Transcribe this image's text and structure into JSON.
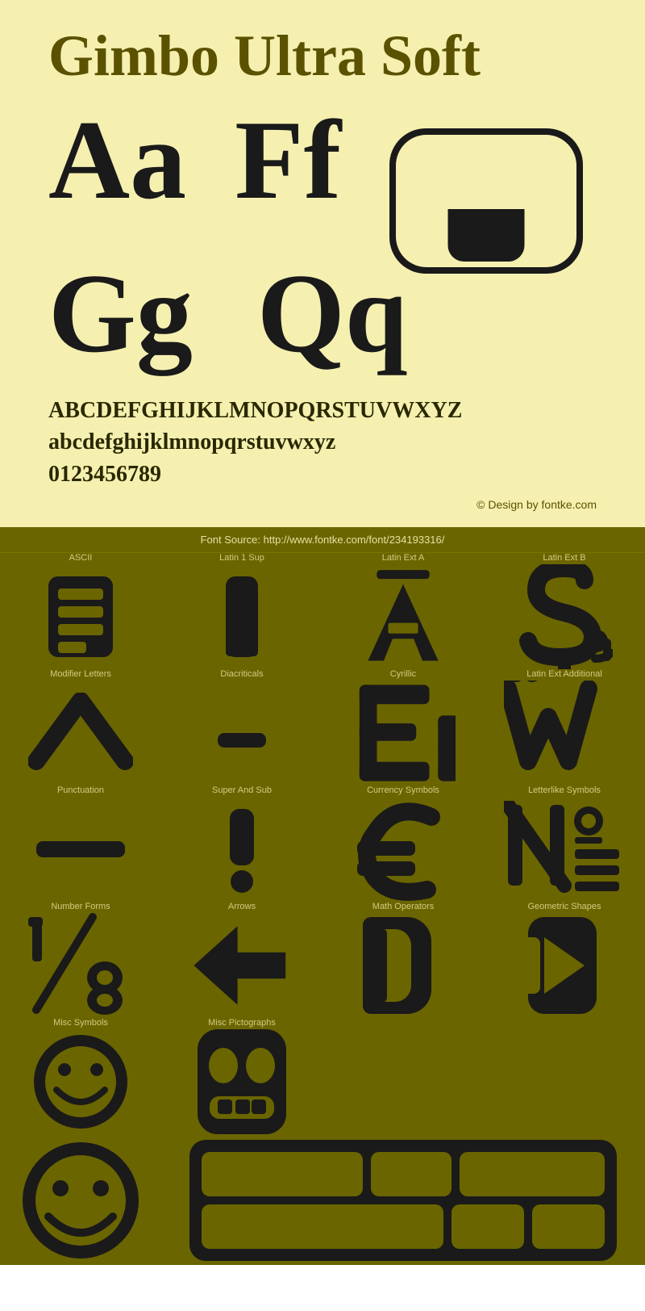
{
  "top": {
    "title": "Gimbo Ultra Soft",
    "glyphs_row1": [
      "Aa",
      "Ff"
    ],
    "glyphs_row2": [
      "Gg",
      "Qq"
    ],
    "alphabet_lines": [
      "ABCDEFGHIJKLMNOPQRSTUVWXYZ",
      "abcdefghijklmnopqrstuvwxyz",
      "0123456789"
    ],
    "copyright": "© Design by fontke.com"
  },
  "bottom": {
    "font_source": "Font Source: http://www.fontke.com/font/234193316/",
    "sections": [
      {
        "label": "ASCII",
        "icon": "ascii"
      },
      {
        "label": "Latin 1 Sup",
        "icon": "latin1sup"
      },
      {
        "label": "Latin Ext A",
        "icon": "latinexta"
      },
      {
        "label": "Latin Ext B",
        "icon": "latinextb"
      },
      {
        "label": "Modifier Letters",
        "icon": "modifier"
      },
      {
        "label": "Diacriticals",
        "icon": "diacriticals"
      },
      {
        "label": "Cyrillic",
        "icon": "cyrillic"
      },
      {
        "label": "Latin Ext Additional",
        "icon": "latinextadd"
      },
      {
        "label": "Punctuation",
        "icon": "punctuation"
      },
      {
        "label": "Super And Sub",
        "icon": "superandsub"
      },
      {
        "label": "Currency Symbols",
        "icon": "currency"
      },
      {
        "label": "Letterlike Symbols",
        "icon": "letterlike"
      },
      {
        "label": "Number Forms",
        "icon": "numberforms"
      },
      {
        "label": "Arrows",
        "icon": "arrows"
      },
      {
        "label": "Math Operators",
        "icon": "mathop"
      },
      {
        "label": "Geometric Shapes",
        "icon": "geoshapes"
      },
      {
        "label": "Misc Symbols",
        "icon": "misc"
      },
      {
        "label": "Misc Pictographs",
        "icon": "miscpict"
      },
      {
        "label": "",
        "icon": "smiley"
      },
      {
        "label": "",
        "icon": "bigblock"
      }
    ]
  }
}
